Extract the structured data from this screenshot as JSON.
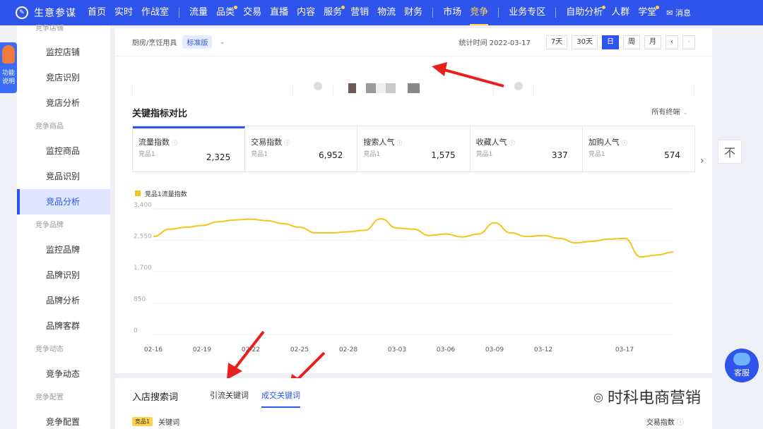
{
  "topnav": {
    "brand": "生意参谋",
    "items": [
      {
        "label": "首页"
      },
      {
        "label": "实时"
      },
      {
        "label": "作战室"
      },
      {
        "label": "流量"
      },
      {
        "label": "品类"
      },
      {
        "label": "交易"
      },
      {
        "label": "直播"
      },
      {
        "label": "内容"
      },
      {
        "label": "服务"
      },
      {
        "label": "营销"
      },
      {
        "label": "物流"
      },
      {
        "label": "财务"
      },
      {
        "label": "市场"
      },
      {
        "label": "竞争"
      },
      {
        "label": "业务专区"
      },
      {
        "label": "自助分析"
      },
      {
        "label": "人群"
      },
      {
        "label": "学堂"
      }
    ],
    "message": "消息"
  },
  "helper": {
    "label": "功能说明"
  },
  "sidebar": {
    "groups": [
      {
        "title": "竞争店铺",
        "items": [
          "监控店铺",
          "竞店识别",
          "竞店分析"
        ]
      },
      {
        "title": "竞争商品",
        "items": [
          "监控商品",
          "竞品识别",
          "竞品分析"
        ]
      },
      {
        "title": "竞争品牌",
        "items": [
          "监控品牌",
          "品牌识别",
          "品牌分析",
          "品牌客群"
        ]
      },
      {
        "title": "竞争动态",
        "items": [
          "竞争动态"
        ]
      },
      {
        "title": "竞争配置",
        "items": [
          "竞争配置"
        ]
      }
    ],
    "active": "竞品分析"
  },
  "filter": {
    "category": "厨房/烹饪用具",
    "version": "标准版",
    "stat_label": "统计时间",
    "stat_date": "2022-03-17",
    "ranges": [
      "7天",
      "30天",
      "日",
      "周",
      "月"
    ],
    "active_range": "日"
  },
  "panel": {
    "title": "关键指标对比",
    "terminal": "所有终端",
    "metrics": [
      {
        "name": "流量指数",
        "sub": "竞品1",
        "value": "2,325"
      },
      {
        "name": "交易指数",
        "sub": "竞品1",
        "value": "6,952"
      },
      {
        "name": "搜索人气",
        "sub": "竞品1",
        "value": "1,575"
      },
      {
        "name": "收藏人气",
        "sub": "竞品1",
        "value": "337"
      },
      {
        "name": "加购人气",
        "sub": "竞品1",
        "value": "574"
      }
    ]
  },
  "chart_data": {
    "type": "line",
    "legend": "竞品1流量指数",
    "series": [
      {
        "name": "竞品1流量指数",
        "color": "#f5c518",
        "values": [
          2650,
          2850,
          2900,
          2950,
          3050,
          3100,
          3120,
          3080,
          3000,
          2900,
          2750,
          2750,
          2780,
          2820,
          3130,
          2880,
          2850,
          2680,
          2720,
          2640,
          2720,
          3020,
          2750,
          2650,
          2680,
          2600,
          2480,
          2520,
          2580,
          2600,
          2100,
          2150,
          2230
        ]
      }
    ],
    "x_ticks": [
      "02-16",
      "02-19",
      "02-22",
      "02-25",
      "02-28",
      "03-03",
      "03-06",
      "03-09",
      "03-12",
      "03-17"
    ],
    "y_ticks": [
      "0",
      "850",
      "1,700",
      "2,550",
      "3,400"
    ],
    "ylim": [
      0,
      3400
    ],
    "grid": true
  },
  "bottom": {
    "title": "入店搜索词",
    "tabs": [
      "引流关键词",
      "成交关键词"
    ],
    "active_tab": "成交关键词",
    "rank_tag": "竞品1",
    "col_keyword": "关键词",
    "col_trade": "交易指数"
  },
  "float": {
    "to_top": "不",
    "service": "客服"
  },
  "watermark": "时科电商营销",
  "colors": {
    "primary": "#2f54eb",
    "accent": "#ffd24d",
    "arrow": "#e8201d"
  }
}
